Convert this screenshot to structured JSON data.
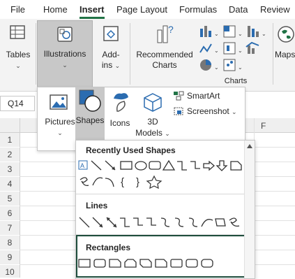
{
  "menu": {
    "tabs": [
      "File",
      "Home",
      "Insert",
      "Page Layout",
      "Formulas",
      "Data",
      "Review"
    ],
    "active_tab": "Insert"
  },
  "ribbon": {
    "tables": "Tables",
    "illustrations": "Illustrations",
    "addins_1": "Add-",
    "addins_2": "ins",
    "recommended_1": "Recommended",
    "recommended_2": "Charts",
    "charts_group": "Charts",
    "maps": "Maps"
  },
  "namebox": {
    "value": "Q14"
  },
  "grid": {
    "column_f": "F",
    "rows": [
      "1",
      "2",
      "3",
      "4",
      "5",
      "6",
      "7",
      "8",
      "9",
      "10"
    ]
  },
  "illustrations_menu": {
    "pictures": "Pictures",
    "shapes": "Shapes",
    "icons": "Icons",
    "models_1": "3D",
    "models_2": "Models",
    "smartart": "SmartArt",
    "screenshot": "Screenshot"
  },
  "shapes_gallery": {
    "recent_heading": "Recently Used Shapes",
    "lines_heading": "Lines",
    "rectangles_heading": "Rectangles"
  },
  "colors": {
    "accent": "#217346",
    "shapes_highlight": "#c8c8c8",
    "icon_blue": "#2b6cb0",
    "rect_border": "#1e4d3c"
  }
}
